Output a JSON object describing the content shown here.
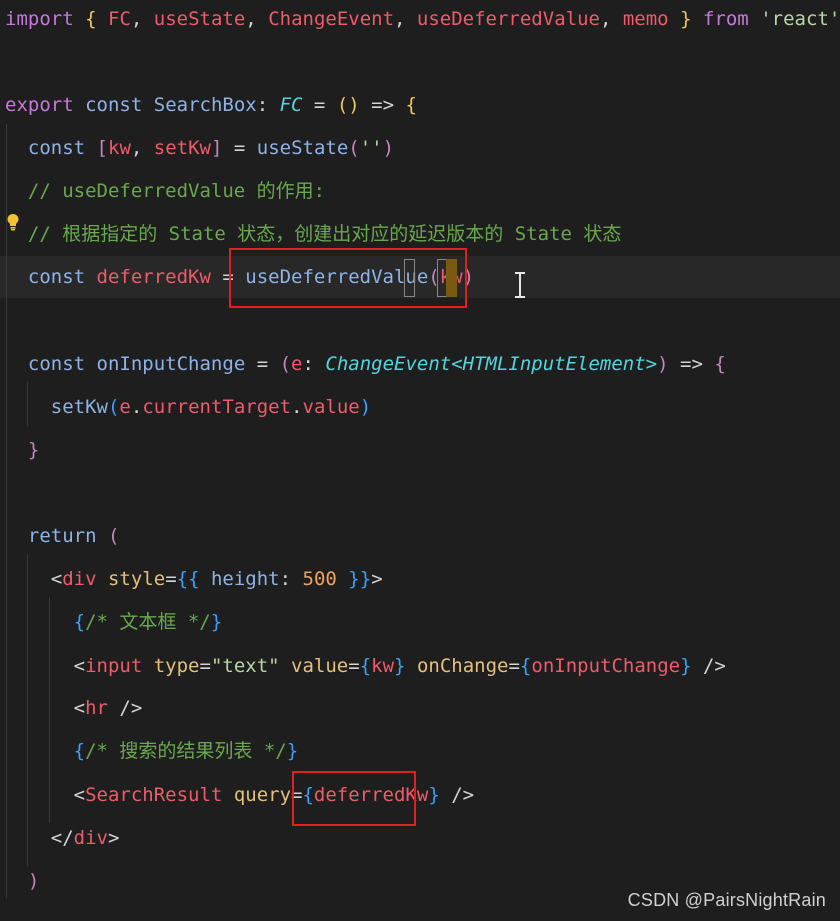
{
  "editor": {
    "language": "tsx",
    "highlight_color": "#e02020",
    "background_color": "#1e1e1e",
    "lines": [
      {
        "id": "l1",
        "segments": [
          {
            "t": "import",
            "c": "import"
          },
          {
            "t": " ",
            "c": "punc"
          },
          {
            "t": "{",
            "c": "br1"
          },
          {
            "t": " ",
            "c": "punc"
          },
          {
            "t": "FC",
            "c": "var"
          },
          {
            "t": ", ",
            "c": "punc"
          },
          {
            "t": "useState",
            "c": "var"
          },
          {
            "t": ", ",
            "c": "punc"
          },
          {
            "t": "ChangeEvent",
            "c": "var"
          },
          {
            "t": ", ",
            "c": "punc"
          },
          {
            "t": "useDeferredValue",
            "c": "var"
          },
          {
            "t": ", ",
            "c": "punc"
          },
          {
            "t": "memo",
            "c": "var"
          },
          {
            "t": " ",
            "c": "punc"
          },
          {
            "t": "}",
            "c": "br1"
          },
          {
            "t": " ",
            "c": "punc"
          },
          {
            "t": "from",
            "c": "import"
          },
          {
            "t": " ",
            "c": "punc"
          },
          {
            "t": "'react'",
            "c": "str"
          }
        ]
      },
      {
        "id": "l2",
        "segments": []
      },
      {
        "id": "l3",
        "segments": [
          {
            "t": "export",
            "c": "import"
          },
          {
            "t": " ",
            "c": "punc"
          },
          {
            "t": "const",
            "c": "decl"
          },
          {
            "t": " ",
            "c": "punc"
          },
          {
            "t": "SearchBox",
            "c": "decl"
          },
          {
            "t": ": ",
            "c": "punc"
          },
          {
            "t": "FC",
            "c": "type"
          },
          {
            "t": " = ",
            "c": "punc"
          },
          {
            "t": "()",
            "c": "br1"
          },
          {
            "t": " => ",
            "c": "punc"
          },
          {
            "t": "{",
            "c": "br1"
          }
        ]
      },
      {
        "id": "l4",
        "segments": [
          {
            "t": "  ",
            "c": "punc"
          },
          {
            "t": "const",
            "c": "decl"
          },
          {
            "t": " ",
            "c": "punc"
          },
          {
            "t": "[",
            "c": "br2"
          },
          {
            "t": "kw",
            "c": "var"
          },
          {
            "t": ", ",
            "c": "punc"
          },
          {
            "t": "setKw",
            "c": "var"
          },
          {
            "t": "]",
            "c": "br2"
          },
          {
            "t": " = ",
            "c": "punc"
          },
          {
            "t": "useState",
            "c": "decl"
          },
          {
            "t": "(",
            "c": "br2"
          },
          {
            "t": "''",
            "c": "str"
          },
          {
            "t": ")",
            "c": "br2"
          }
        ]
      },
      {
        "id": "l5",
        "segments": [
          {
            "t": "  // useDeferredValue 的作用:",
            "c": "com"
          }
        ]
      },
      {
        "id": "l6",
        "segments": [
          {
            "t": "  // 根据指定的 State 状态，创建出对应的延迟版本的 State 状态",
            "c": "com"
          }
        ]
      },
      {
        "id": "l7",
        "segments": [
          {
            "t": "  ",
            "c": "punc"
          },
          {
            "t": "const",
            "c": "decl"
          },
          {
            "t": " ",
            "c": "punc"
          },
          {
            "t": "deferredKw",
            "c": "var"
          },
          {
            "t": " = ",
            "c": "punc"
          },
          {
            "t": "useDeferredValue",
            "c": "decl"
          },
          {
            "t": "(",
            "c": "br2"
          },
          {
            "t": "kw",
            "c": "var"
          },
          {
            "t": ")",
            "c": "br2"
          }
        ]
      },
      {
        "id": "l8",
        "segments": []
      },
      {
        "id": "l9",
        "segments": [
          {
            "t": "  ",
            "c": "punc"
          },
          {
            "t": "const",
            "c": "decl"
          },
          {
            "t": " ",
            "c": "punc"
          },
          {
            "t": "onInputChange",
            "c": "decl"
          },
          {
            "t": " = ",
            "c": "punc"
          },
          {
            "t": "(",
            "c": "br2"
          },
          {
            "t": "e",
            "c": "var"
          },
          {
            "t": ": ",
            "c": "punc"
          },
          {
            "t": "ChangeEvent<HTMLInputElement>",
            "c": "type"
          },
          {
            "t": ")",
            "c": "br2"
          },
          {
            "t": " => ",
            "c": "punc"
          },
          {
            "t": "{",
            "c": "br2"
          }
        ]
      },
      {
        "id": "l10",
        "segments": [
          {
            "t": "    ",
            "c": "punc"
          },
          {
            "t": "setKw",
            "c": "decl"
          },
          {
            "t": "(",
            "c": "br3"
          },
          {
            "t": "e",
            "c": "var"
          },
          {
            "t": ".",
            "c": "punc"
          },
          {
            "t": "currentTarget",
            "c": "var"
          },
          {
            "t": ".",
            "c": "punc"
          },
          {
            "t": "value",
            "c": "var"
          },
          {
            "t": ")",
            "c": "br3"
          }
        ]
      },
      {
        "id": "l11",
        "segments": [
          {
            "t": "  ",
            "c": "punc"
          },
          {
            "t": "}",
            "c": "br2"
          }
        ]
      },
      {
        "id": "l12",
        "segments": []
      },
      {
        "id": "l13",
        "segments": [
          {
            "t": "  ",
            "c": "punc"
          },
          {
            "t": "return",
            "c": "decl"
          },
          {
            "t": " ",
            "c": "punc"
          },
          {
            "t": "(",
            "c": "br2"
          }
        ]
      },
      {
        "id": "l14",
        "segments": [
          {
            "t": "    <",
            "c": "punc"
          },
          {
            "t": "div",
            "c": "tag"
          },
          {
            "t": " ",
            "c": "punc"
          },
          {
            "t": "style",
            "c": "attr"
          },
          {
            "t": "=",
            "c": "punc"
          },
          {
            "t": "{{",
            "c": "br3"
          },
          {
            "t": " ",
            "c": "punc"
          },
          {
            "t": "height",
            "c": "decl"
          },
          {
            "t": ": ",
            "c": "punc"
          },
          {
            "t": "500",
            "c": "num"
          },
          {
            "t": " ",
            "c": "punc"
          },
          {
            "t": "}}",
            "c": "br3"
          },
          {
            "t": ">",
            "c": "punc"
          }
        ]
      },
      {
        "id": "l15",
        "segments": [
          {
            "t": "      ",
            "c": "punc"
          },
          {
            "t": "{",
            "c": "br3"
          },
          {
            "t": "/* 文本框 */",
            "c": "com"
          },
          {
            "t": "}",
            "c": "br3"
          }
        ]
      },
      {
        "id": "l16",
        "segments": [
          {
            "t": "      <",
            "c": "punc"
          },
          {
            "t": "input",
            "c": "tag"
          },
          {
            "t": " ",
            "c": "punc"
          },
          {
            "t": "type",
            "c": "attr"
          },
          {
            "t": "=",
            "c": "punc"
          },
          {
            "t": "\"text\"",
            "c": "str"
          },
          {
            "t": " ",
            "c": "punc"
          },
          {
            "t": "value",
            "c": "attr"
          },
          {
            "t": "=",
            "c": "punc"
          },
          {
            "t": "{",
            "c": "br3"
          },
          {
            "t": "kw",
            "c": "var"
          },
          {
            "t": "}",
            "c": "br3"
          },
          {
            "t": " ",
            "c": "punc"
          },
          {
            "t": "onChange",
            "c": "attr"
          },
          {
            "t": "=",
            "c": "punc"
          },
          {
            "t": "{",
            "c": "br3"
          },
          {
            "t": "onInputChange",
            "c": "var"
          },
          {
            "t": "}",
            "c": "br3"
          },
          {
            "t": " />",
            "c": "punc"
          }
        ]
      },
      {
        "id": "l17",
        "segments": [
          {
            "t": "      <",
            "c": "punc"
          },
          {
            "t": "hr",
            "c": "tag"
          },
          {
            "t": " />",
            "c": "punc"
          }
        ]
      },
      {
        "id": "l18",
        "segments": [
          {
            "t": "      ",
            "c": "punc"
          },
          {
            "t": "{",
            "c": "br3"
          },
          {
            "t": "/* 搜索的结果列表 */",
            "c": "com"
          },
          {
            "t": "}",
            "c": "br3"
          }
        ]
      },
      {
        "id": "l19",
        "segments": [
          {
            "t": "      <",
            "c": "punc"
          },
          {
            "t": "SearchResult",
            "c": "tag"
          },
          {
            "t": " ",
            "c": "punc"
          },
          {
            "t": "query",
            "c": "attr"
          },
          {
            "t": "=",
            "c": "punc"
          },
          {
            "t": "{",
            "c": "br3"
          },
          {
            "t": "deferredKw",
            "c": "var"
          },
          {
            "t": "}",
            "c": "br3"
          },
          {
            "t": " />",
            "c": "punc"
          }
        ]
      },
      {
        "id": "l20",
        "segments": [
          {
            "t": "    </",
            "c": "punc"
          },
          {
            "t": "div",
            "c": "tag"
          },
          {
            "t": ">",
            "c": "punc"
          }
        ]
      },
      {
        "id": "l21",
        "segments": [
          {
            "t": "  ",
            "c": "punc"
          },
          {
            "t": ")",
            "c": "br2"
          }
        ]
      }
    ]
  },
  "watermark": "CSDN @PairsNightRain"
}
